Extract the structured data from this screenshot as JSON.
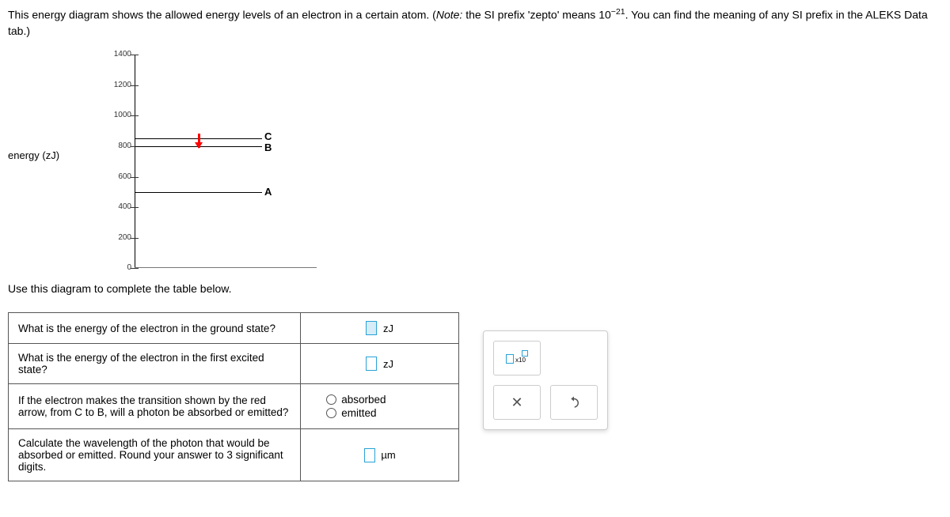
{
  "intro": {
    "part1": "This energy diagram shows the allowed energy levels of an electron in a certain atom. (",
    "note_label": "Note:",
    "part2": " the SI prefix 'zepto' means ",
    "base": "10",
    "exp": "−21",
    "part3": ". You can find the meaning of any SI prefix in the ALEKS Data tab.)"
  },
  "diagram": {
    "ylabel": "energy (zJ)",
    "ticks": [
      "1400",
      "1200",
      "1000",
      "800",
      "600",
      "400",
      "200",
      "0"
    ],
    "levels": {
      "A": {
        "label": "A",
        "energy": 500
      },
      "B": {
        "label": "B",
        "energy": 800
      },
      "C": {
        "label": "C",
        "energy": 850
      }
    },
    "arrow": {
      "from": "C",
      "to": "B",
      "color": "red"
    }
  },
  "subheading": "Use this diagram to complete the table below.",
  "questions": {
    "q1": "What is the energy of the electron in the ground state?",
    "q2": "What is the energy of the electron in the first excited state?",
    "q3": "If the electron makes the transition shown by the red arrow, from C to B, will a photon be absorbed or emitted?",
    "q4": "Calculate the wavelength of the photon that would be absorbed or emitted. Round your answer to 3 significant digits."
  },
  "units": {
    "zj": "zJ",
    "um": "µm"
  },
  "radio": {
    "opt1": "absorbed",
    "opt2": "emitted"
  },
  "keypad": {
    "x10_label": "x10"
  }
}
